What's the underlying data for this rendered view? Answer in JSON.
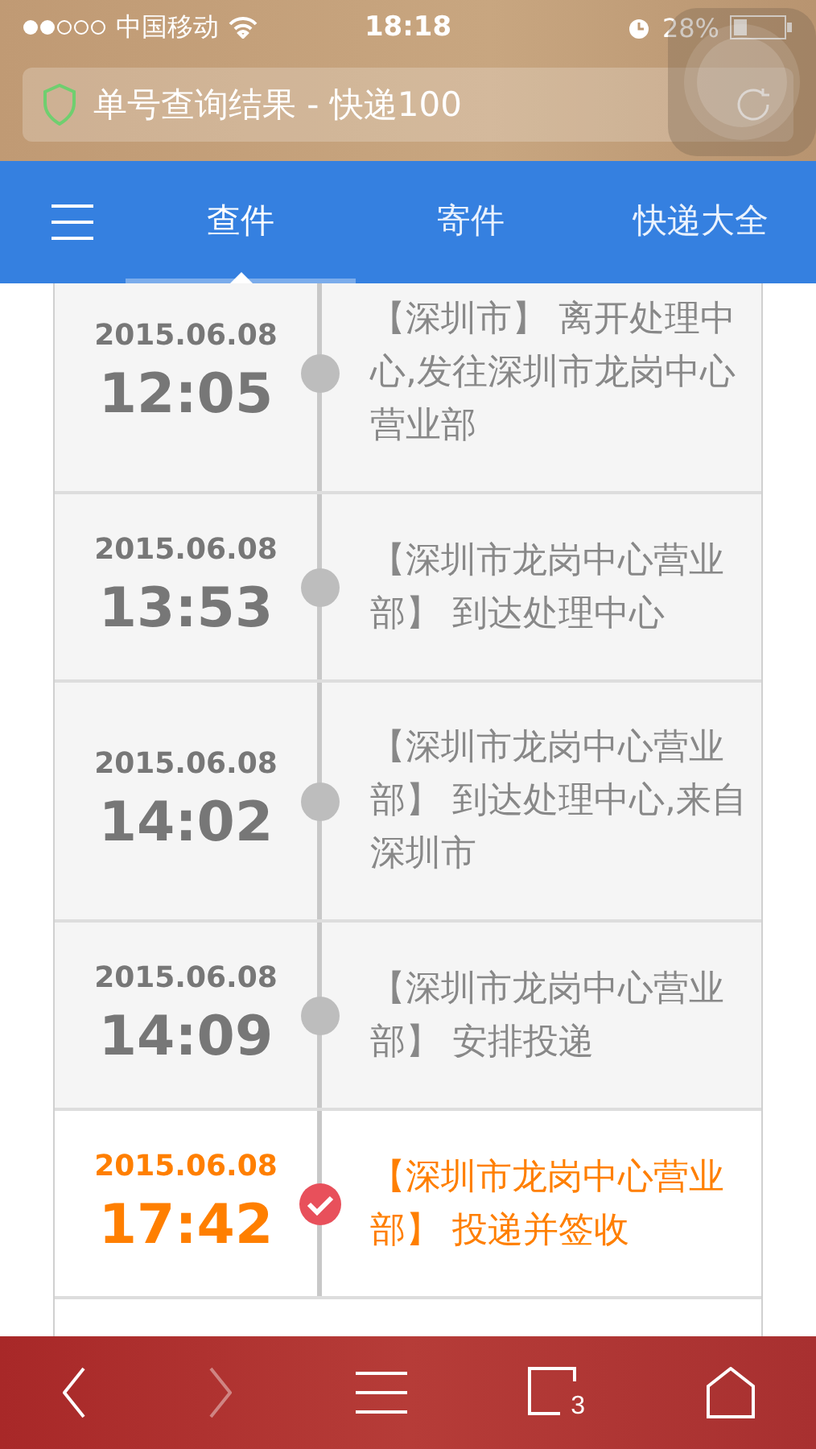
{
  "status_bar": {
    "carrier": "中国移动",
    "time": "18:18",
    "battery": "28%"
  },
  "address_bar": {
    "title": "单号查询结果 - 快递100"
  },
  "nav": {
    "tabs": [
      {
        "label": "查件",
        "selected": true
      },
      {
        "label": "寄件",
        "selected": false
      },
      {
        "label": "快递大全",
        "selected": false
      }
    ]
  },
  "timeline": [
    {
      "date": "2015.06.08",
      "time": "12:05",
      "text": "【深圳市】 离开处理中心,发往深圳市龙岗中心营业部",
      "current": false
    },
    {
      "date": "2015.06.08",
      "time": "13:53",
      "text": "【深圳市龙岗中心营业部】 到达处理中心",
      "current": false
    },
    {
      "date": "2015.06.08",
      "time": "14:02",
      "text": "【深圳市龙岗中心营业部】 到达处理中心,来自深圳市",
      "current": false
    },
    {
      "date": "2015.06.08",
      "time": "14:09",
      "text": "【深圳市龙岗中心营业部】 安排投递",
      "current": false
    },
    {
      "date": "2015.06.08",
      "time": "17:42",
      "text": "【深圳市龙岗中心营业部】 投递并签收",
      "current": true
    }
  ],
  "toolbar": {
    "back_disabled": false,
    "forward_disabled": true,
    "tab_count": "3"
  }
}
